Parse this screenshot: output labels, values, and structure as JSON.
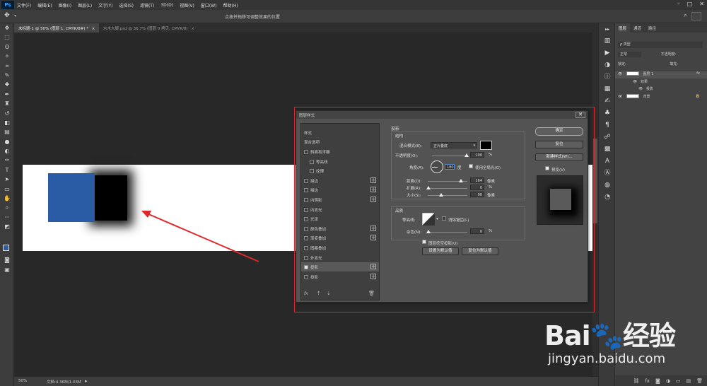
{
  "app": {
    "logo": "Ps"
  },
  "menu": [
    "文件(F)",
    "编辑(E)",
    "图像(I)",
    "图层(L)",
    "文字(Y)",
    "选择(S)",
    "滤镜(T)",
    "3D(D)",
    "视图(V)",
    "窗口(W)",
    "帮助(H)"
  ],
  "window_controls": [
    "–",
    "□",
    "✕"
  ],
  "options_bar": {
    "hint": "点按并拖移可调整效果的位置"
  },
  "tabs": [
    {
      "label": "未标题-1 @ 50% (图层 1, CMYK/8#) *",
      "close": "×"
    },
    {
      "label": "水木大脚.psd @ 36.7% (图层 0 拷贝, CMYK/8)",
      "close": "×"
    }
  ],
  "status": {
    "zoom": "50%",
    "doc": "文档:4.36M/1.03M"
  },
  "layers_panel": {
    "tabs": [
      "图层",
      "通道",
      "路径"
    ],
    "kind_label": "ρ 类型",
    "blend": "正常",
    "opacity_label": "不透明度:",
    "lock_label": "锁定:",
    "fill_label": "填充:",
    "layer1": "图层 1",
    "fx": "fx",
    "effects": "效果",
    "drop_shadow": "投影",
    "background": "背景"
  },
  "dialog": {
    "title": "图层样式",
    "styles_header": "样式",
    "blend_options": "混合选项",
    "items": [
      {
        "label": "斜面和浮雕",
        "checked": false,
        "plus": false,
        "indent": false
      },
      {
        "label": "等高线",
        "checked": false,
        "plus": false,
        "indent": true
      },
      {
        "label": "纹理",
        "checked": false,
        "plus": false,
        "indent": true
      },
      {
        "label": "描边",
        "checked": false,
        "plus": true,
        "indent": false
      },
      {
        "label": "描边",
        "checked": false,
        "plus": true,
        "indent": false
      },
      {
        "label": "内阴影",
        "checked": false,
        "plus": true,
        "indent": false
      },
      {
        "label": "内发光",
        "checked": false,
        "plus": false,
        "indent": false
      },
      {
        "label": "光泽",
        "checked": false,
        "plus": false,
        "indent": false
      },
      {
        "label": "颜色叠加",
        "checked": false,
        "plus": true,
        "indent": false
      },
      {
        "label": "渐变叠加",
        "checked": false,
        "plus": true,
        "indent": false
      },
      {
        "label": "图案叠加",
        "checked": false,
        "plus": false,
        "indent": false
      },
      {
        "label": "外发光",
        "checked": false,
        "plus": false,
        "indent": false
      },
      {
        "label": "投影",
        "checked": true,
        "plus": true,
        "indent": false,
        "selected": true
      },
      {
        "label": "投影",
        "checked": false,
        "plus": true,
        "indent": false
      }
    ],
    "footer_fx": "fx",
    "section_title": "投影",
    "structure": "结构",
    "blend_mode_label": "混合模式(B):",
    "blend_mode_value": "正片叠底",
    "opacity_label": "不透明度(O):",
    "opacity_value": "100",
    "pct": "%",
    "angle_label": "角度(A):",
    "angle_value": "180",
    "degree": "度",
    "global_light": "使用全局光(G)",
    "distance_label": "距离(D):",
    "distance_value": "164",
    "spread_label": "扩展(R):",
    "spread_value": "0",
    "size_label": "大小(S):",
    "size_value": "90",
    "px": "像素",
    "quality": "品质",
    "contour_label": "等高线:",
    "antialias": "消除锯齿(L)",
    "noise_label": "杂色(N):",
    "noise_value": "0",
    "knockout": "图层挖空投影(U)",
    "set_default": "设置为默认值",
    "reset_default": "复位为默认值",
    "ok": "确定",
    "reset": "复位",
    "new_style": "新建样式(W)...",
    "preview": "预览(V)"
  },
  "watermark": {
    "logo": "Bai🐾经验",
    "url": "jingyan.baidu.com"
  },
  "colors": {
    "accent_blue": "#2a5ca6",
    "annotation_red": "#e0282c",
    "shadow": "#000000"
  }
}
